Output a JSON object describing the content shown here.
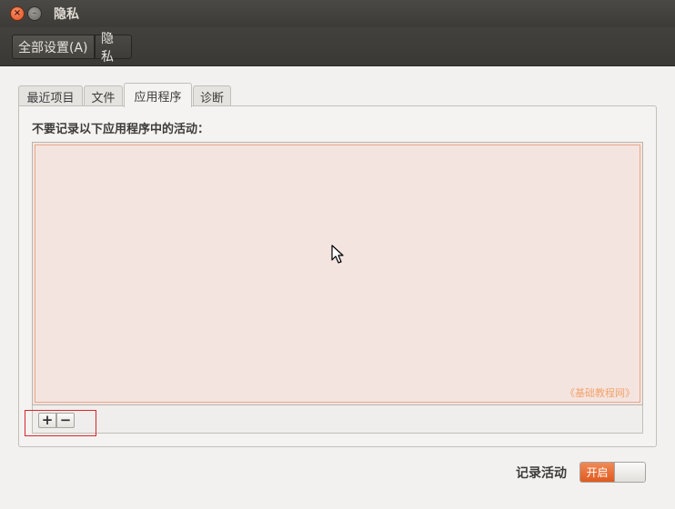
{
  "window": {
    "title": "隐私",
    "close_glyph": "×",
    "minimize_glyph": "–",
    "icons": [
      "close-icon",
      "minimize-icon"
    ]
  },
  "toolbar": {
    "all_settings_label": "全部设置(A)",
    "current_label": "隐私"
  },
  "tabs": [
    {
      "label": "最近项目",
      "active": false
    },
    {
      "label": "文件",
      "active": false
    },
    {
      "label": "应用程序",
      "active": true
    },
    {
      "label": "诊断",
      "active": false
    }
  ],
  "applications_page": {
    "heading": "不要记录以下应用程序中的活动：",
    "items": [],
    "watermark": "《基础教程网》",
    "add_label": "+",
    "remove_label": "−",
    "accent_color": "#e05a1f"
  },
  "record_activity": {
    "label": "记录活动",
    "state_label": "开启",
    "enabled": true
  }
}
